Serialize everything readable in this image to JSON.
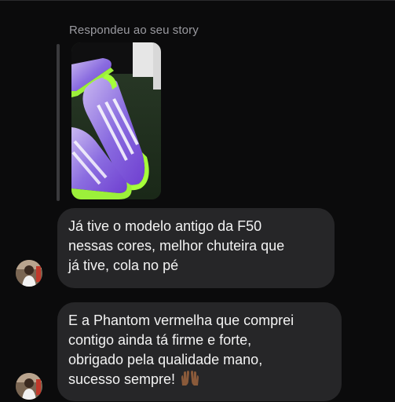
{
  "reply_context": {
    "caption": "Respondeu ao seu story",
    "story_image": "green-purple-football-boots-photo"
  },
  "messages": [
    {
      "lines": [
        "Já tive o modelo antigo da F50",
        "nessas cores, melhor chuteira que",
        "já tive, cola no pé"
      ],
      "emoji": ""
    },
    {
      "lines": [
        "E a Phantom vermelha que comprei",
        "contigo ainda tá firme e forte,",
        "obrigado pela qualidade mano,",
        "sucesso sempre!"
      ],
      "emoji": "raising-hands-icon"
    }
  ],
  "colors": {
    "background": "#0b0b0c",
    "bubble": "#262628",
    "caption": "#9a9aa0",
    "text": "#f3f3f3"
  }
}
